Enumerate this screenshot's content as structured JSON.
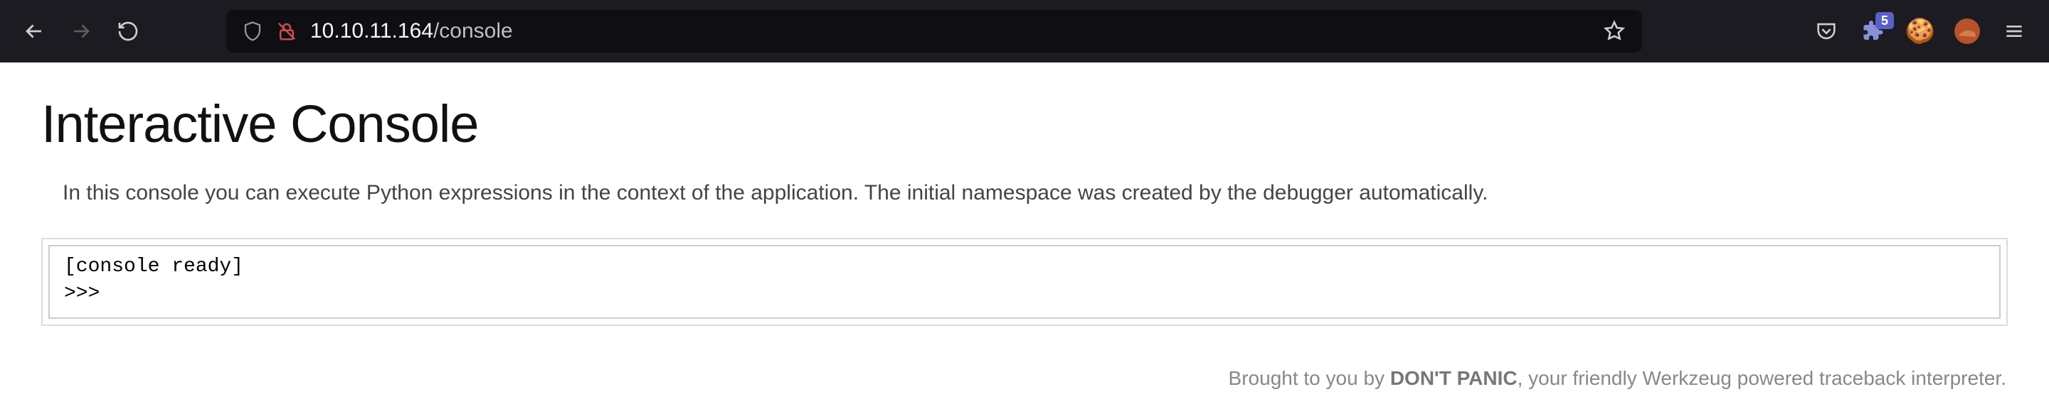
{
  "browser": {
    "url_host": "10.10.11.164",
    "url_path": "/console",
    "badge_count": "5"
  },
  "page": {
    "title": "Interactive Console",
    "intro": "In this console you can execute Python expressions in the context of the application. The initial namespace was created by the debugger automatically.",
    "console_ready": "[console ready]",
    "console_prompt": ">>>",
    "footer_prefix": "Brought to you by ",
    "footer_brand": "DON'T PANIC",
    "footer_suffix": ", your friendly Werkzeug powered traceback interpreter."
  }
}
